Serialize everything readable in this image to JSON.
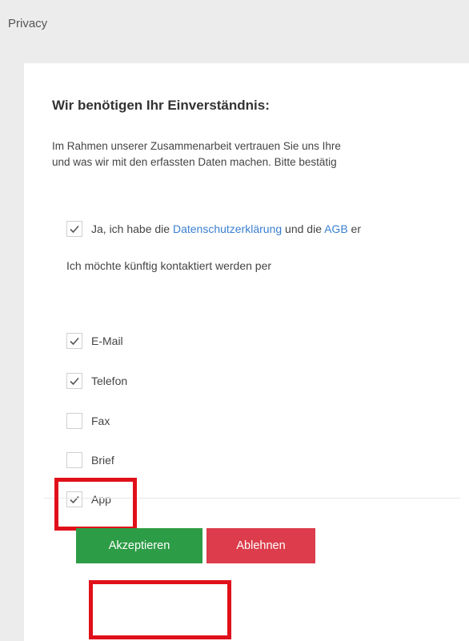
{
  "page": {
    "title": "Privacy"
  },
  "consent": {
    "heading": "Wir benötigen Ihr Einverständnis:",
    "intro_line1": "Im Rahmen unserer Zusammenarbeit vertrauen Sie uns Ihre",
    "intro_line2": "und was wir mit den erfassten Daten machen. Bitte bestätig",
    "agree": {
      "checked": true,
      "text_before": "Ja, ich habe die ",
      "link_privacy": "Datenschutzerklärung",
      "text_middle": " und die ",
      "link_terms": "AGB",
      "text_after": " er"
    },
    "contact_label": "Ich möchte künftig kontaktiert werden per",
    "options": [
      {
        "label": "E-Mail",
        "checked": true
      },
      {
        "label": "Telefon",
        "checked": true
      },
      {
        "label": "Fax",
        "checked": false
      },
      {
        "label": "Brief",
        "checked": false
      },
      {
        "label": "App",
        "checked": true
      }
    ]
  },
  "actions": {
    "accept_label": "Akzeptieren",
    "decline_label": "Ablehnen"
  },
  "colors": {
    "accept": "#2d9c46",
    "decline": "#dc3c4b",
    "link": "#3a7fd0",
    "highlight": "#e0101a"
  }
}
